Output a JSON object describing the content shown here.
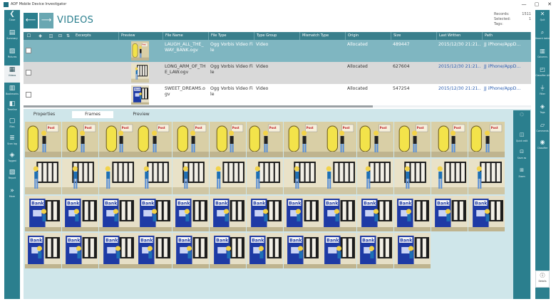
{
  "window": {
    "title": "ADF Mobile Device Investigator",
    "controls": [
      "—",
      "▢",
      "✕"
    ]
  },
  "left_nav": [
    {
      "id": "close",
      "label": "Close",
      "icon": "chevron-left-icon",
      "glyph": "❮"
    },
    {
      "id": "summary",
      "label": "Summary",
      "icon": "summary-icon",
      "glyph": "▤"
    },
    {
      "id": "pictures",
      "label": "Pictures",
      "icon": "pictures-icon",
      "glyph": "▨"
    },
    {
      "id": "videos",
      "label": "Videos",
      "icon": "film-icon",
      "glyph": "▦"
    },
    {
      "id": "bookmarks",
      "label": "Bookmarks",
      "icon": "bookmark-icon",
      "glyph": "▥"
    },
    {
      "id": "timeline",
      "label": "Timeline",
      "icon": "timeline-icon",
      "glyph": "◧"
    },
    {
      "id": "files",
      "label": "Files",
      "icon": "file-icon",
      "glyph": "▢"
    },
    {
      "id": "scan-log",
      "label": "Scan log",
      "icon": "scan-log-icon",
      "glyph": "≣"
    },
    {
      "id": "tagged",
      "label": "Tagged",
      "icon": "tag-icon",
      "glyph": "◈"
    },
    {
      "id": "report",
      "label": "Report",
      "icon": "report-icon",
      "glyph": "▧"
    },
    {
      "id": "more",
      "label": "More",
      "icon": "double-chevron-right-icon",
      "glyph": "»"
    }
  ],
  "right_nav": [
    {
      "id": "quit",
      "label": "Quit",
      "icon": "close-box-icon",
      "glyph": "✕"
    },
    {
      "id": "search-tables",
      "label": "Search tables",
      "icon": "search-icon",
      "glyph": "⌕"
    },
    {
      "id": "columns",
      "label": "Columns",
      "icon": "columns-icon",
      "glyph": "▥"
    },
    {
      "id": "classifier-all",
      "label": "Classifier All",
      "icon": "classifier-icon",
      "glyph": "◰"
    },
    {
      "id": "filter",
      "label": "Filter",
      "icon": "filter-icon",
      "glyph": "⏚"
    },
    {
      "id": "tags",
      "label": "Tags",
      "icon": "tag-icon",
      "glyph": "◈"
    },
    {
      "id": "comments",
      "label": "Comments",
      "icon": "comment-icon",
      "glyph": "▱"
    },
    {
      "id": "classifier",
      "label": "Classifier",
      "icon": "eye-icon",
      "glyph": "◉"
    }
  ],
  "details_button": {
    "label": "Details",
    "glyph": "ⓘ"
  },
  "header": {
    "back_glyph": "⟵",
    "fwd_glyph": "⟶",
    "title": "VIDEOS"
  },
  "summary": {
    "records_label": "Records:",
    "records_value": "1511",
    "selected_label": "Selected:",
    "selected_value": "1",
    "tags_label": "Tags:",
    "tags_value": ""
  },
  "table": {
    "columns": [
      "Excerpts",
      "Preview",
      "File Name",
      "File Type",
      "Type Group",
      "Mismatch Type",
      "Origin",
      "Size",
      "Last Written",
      "Path"
    ],
    "rows": [
      {
        "file_name": "LAUGH_ALL_THE_WAY_BANK.ogv",
        "file_type": "Ogg Vorbis Video File",
        "type_group": "Video",
        "mismatch": "",
        "origin": "Allocated",
        "size": "489447",
        "last_written": "2015/12/30 21:21...",
        "path": "JJ iPhone/AppD..."
      },
      {
        "file_name": "LONG_ARM_OF_THE_LAW.ogv",
        "file_type": "Ogg Vorbis Video File",
        "type_group": "Video",
        "mismatch": "",
        "origin": "Allocated",
        "size": "627604",
        "last_written": "2015/12/30 21:21...",
        "path": "JJ iPhone/AppD..."
      },
      {
        "file_name": "SWEET_DREAMS.ogv",
        "file_type": "Ogg Vorbis Video File",
        "type_group": "Video",
        "mismatch": "",
        "origin": "Allocated",
        "size": "547254",
        "last_written": "2015/12/30 21:21...",
        "path": "JJ iPhone/AppD..."
      }
    ]
  },
  "panel": {
    "tabs": [
      "Properties",
      "Frames",
      "Preview"
    ],
    "active_tab": "Frames",
    "frame_sign_text": {
      "post": "Post Office",
      "bank": "Bank"
    },
    "frames": [
      "A",
      "A",
      "A",
      "A",
      "A",
      "A",
      "A",
      "A",
      "A",
      "A",
      "A",
      "A",
      "A",
      "B",
      "B",
      "B",
      "B",
      "B",
      "B",
      "B",
      "B",
      "B",
      "B",
      "B",
      "B",
      "B",
      "C",
      "C",
      "C",
      "C",
      "C",
      "C",
      "C",
      "C",
      "C",
      "C",
      "C",
      "C",
      "C",
      "C",
      "C",
      "C",
      "C",
      "C",
      "C",
      "C",
      "C",
      "C",
      "C",
      "C"
    ]
  },
  "tools": [
    {
      "id": "tool-1",
      "label": "",
      "glyph": "⌬",
      "dim": true
    },
    {
      "id": "quick-edit",
      "label": "Quick edit",
      "glyph": "◫",
      "dim": false
    },
    {
      "id": "save-as",
      "label": "Save as",
      "glyph": "⊡",
      "dim": false
    },
    {
      "id": "zoom",
      "label": "Zoom",
      "glyph": "⊞",
      "dim": false
    }
  ],
  "colors": {
    "accent": "#2b7f8e",
    "header": "#3a7f8c",
    "selected_row": "#7fb6c1",
    "panel_bg": "#cfe6ea"
  }
}
